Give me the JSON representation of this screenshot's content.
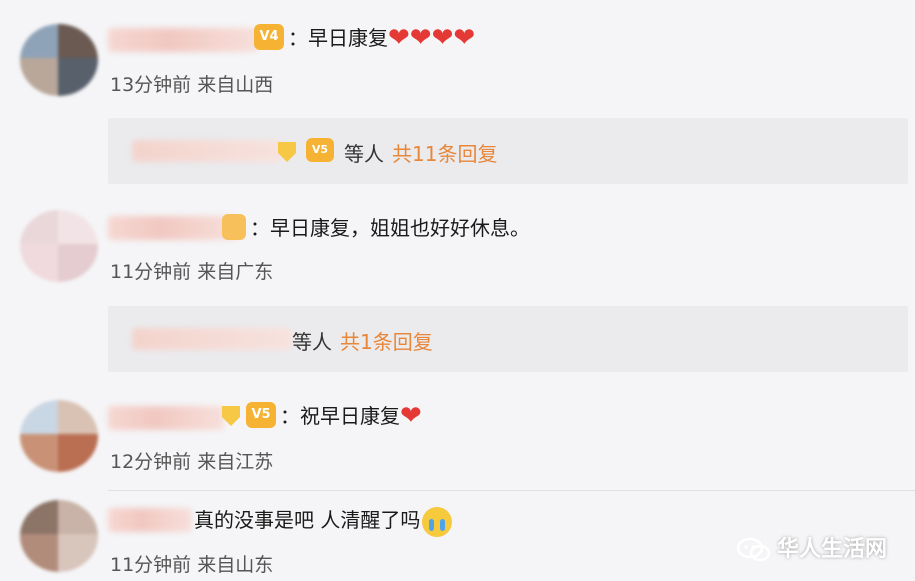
{
  "comments": [
    {
      "vip_label": "V4",
      "text": "早日康复",
      "hearts": "❤❤❤❤",
      "time": "13分钟前",
      "location": "来自山西",
      "reply": {
        "others": "等人",
        "count": "共11条回复"
      }
    },
    {
      "vip_label": "",
      "text": "早日康复，姐姐也好好休息。",
      "time": "11分钟前",
      "location": "来自广东",
      "reply": {
        "others": "等人",
        "count": "共1条回复"
      }
    },
    {
      "vip_label": "V5",
      "text": "祝早日康复",
      "hearts": "❤",
      "time": "12分钟前",
      "location": "来自江苏"
    },
    {
      "text": "真的没事是吧 人清醒了吗",
      "time": "11分钟前",
      "location": "来自山东"
    }
  ],
  "separator": "：",
  "watermark": "华人生活网",
  "colors": {
    "accent": "#e8873a",
    "heart": "#e53935",
    "vip": "#f6b232"
  }
}
